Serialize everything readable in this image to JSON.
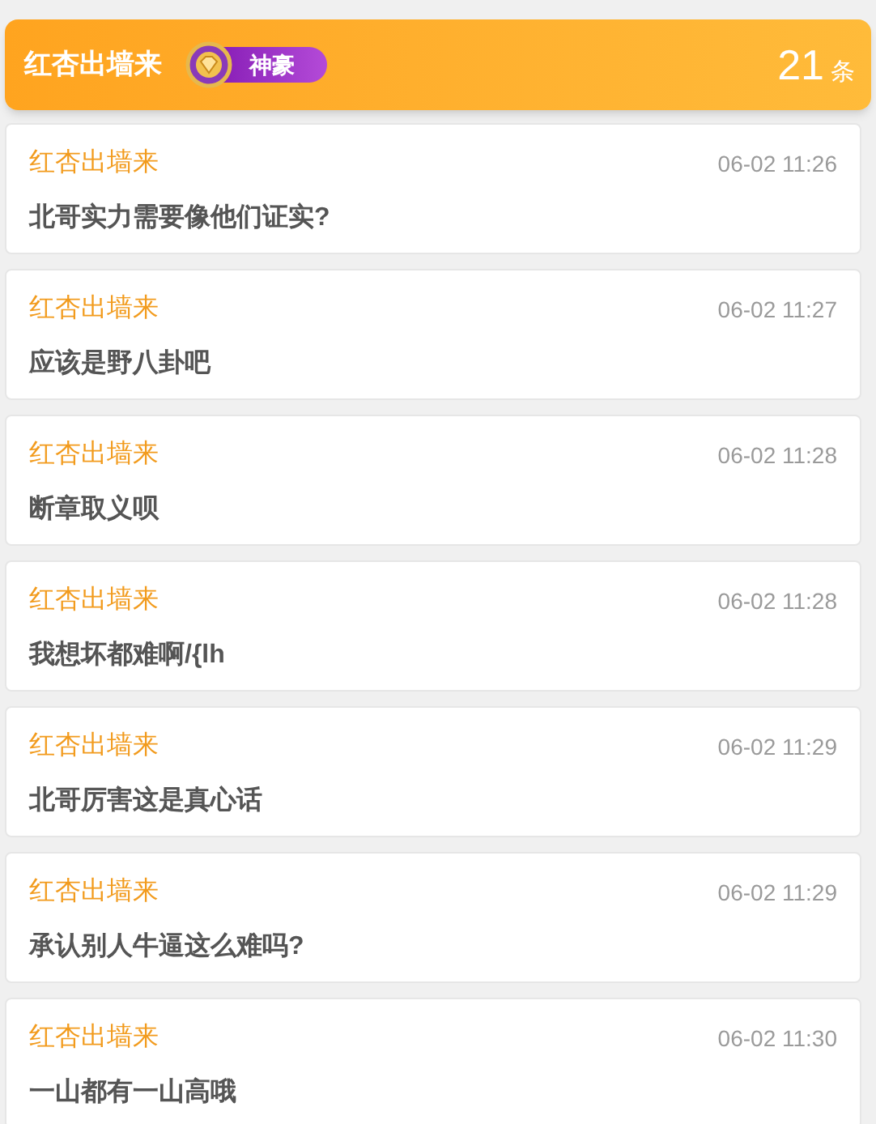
{
  "header": {
    "user": "红杏出墙来",
    "badge": "神豪",
    "count": "21",
    "count_unit": "条"
  },
  "messages": [
    {
      "user": "红杏出墙来",
      "time": "06-02 11:26",
      "text": "北哥实力需要像他们证实?"
    },
    {
      "user": "红杏出墙来",
      "time": "06-02 11:27",
      "text": "应该是野八卦吧"
    },
    {
      "user": "红杏出墙来",
      "time": "06-02 11:28",
      "text": "断章取义呗"
    },
    {
      "user": "红杏出墙来",
      "time": "06-02 11:28",
      "text": "我想坏都难啊/{lh"
    },
    {
      "user": "红杏出墙来",
      "time": "06-02 11:29",
      "text": "北哥厉害这是真心话"
    },
    {
      "user": "红杏出墙来",
      "time": "06-02 11:29",
      "text": "承认别人牛逼这么难吗?"
    },
    {
      "user": "红杏出墙来",
      "time": "06-02 11:30",
      "text": "一山都有一山高哦"
    }
  ]
}
